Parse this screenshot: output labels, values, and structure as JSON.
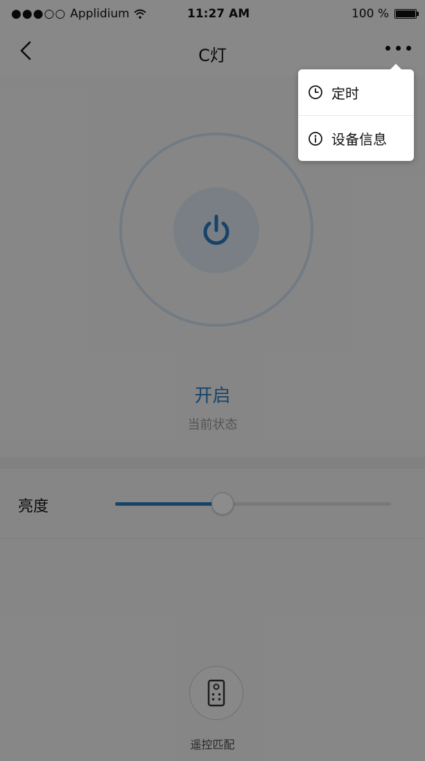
{
  "status_bar": {
    "carrier": "Applidium",
    "signal_dots": "●●●○○",
    "time": "11:27 AM",
    "battery_percent": "100 %"
  },
  "nav": {
    "title": "C灯"
  },
  "device": {
    "status_value": "开启",
    "status_label": "当前状态",
    "brightness_label": "亮度",
    "brightness_level": 0.39
  },
  "bottom": {
    "remote_label": "遥控匹配"
  },
  "popover_menu": {
    "items": [
      {
        "label": "定时",
        "icon": "clock-icon"
      },
      {
        "label": "设备信息",
        "icon": "info-icon"
      }
    ]
  },
  "colors": {
    "accent": "#2d7bbf",
    "ring": "#cfe0ef",
    "power_bg": "#dde7f0",
    "overlay": "rgba(0,0,0,0.45)"
  }
}
